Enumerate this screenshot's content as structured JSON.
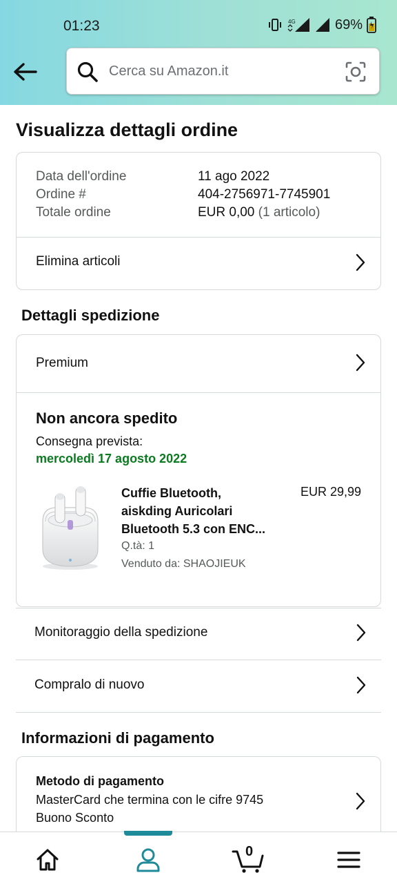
{
  "status_bar": {
    "time": "01:23",
    "battery": "69%",
    "network": "4G"
  },
  "search": {
    "placeholder": "Cerca su Amazon.it"
  },
  "page_title": "Visualizza dettagli ordine",
  "summary": {
    "rows": [
      {
        "label": "Data dell'ordine",
        "value": "11 ago 2022",
        "extra": ""
      },
      {
        "label": "Ordine #",
        "value": "404-2756971-7745901",
        "extra": ""
      },
      {
        "label": "Totale ordine",
        "value": "EUR 0,00",
        "extra": "(1 articolo)"
      }
    ],
    "delete_items": "Elimina articoli"
  },
  "shipping": {
    "section_title": "Dettagli spedizione",
    "method": "Premium",
    "status": "Non ancora spedito",
    "expected_label": "Consegna prevista:",
    "expected_date": "mercoledì 17 agosto 2022",
    "product": {
      "title_line1": "Cuffie Bluetooth,",
      "title_line2": "aiskding Auricolari",
      "title_line3": "Bluetooth 5.3 con ENC...",
      "price": "EUR 29,99",
      "qty": "Q.tà: 1",
      "seller": "Venduto da: SHAOJIEUK"
    }
  },
  "actions": {
    "track": "Monitoraggio della spedizione",
    "buy_again": "Compralo di nuovo"
  },
  "payment": {
    "section_title": "Informazioni di pagamento",
    "method_title": "Metodo di pagamento",
    "line1": "MasterCard che termina con le cifre 9745",
    "line2": "Buono Sconto"
  },
  "bottom_nav": {
    "cart_count": "0",
    "items": [
      "home-icon",
      "account-icon",
      "cart-icon",
      "menu-icon"
    ],
    "active": "account-icon"
  },
  "colors": {
    "accent": "#1f8a9a",
    "delivery_green": "#0c7a21",
    "header_gradient_start": "#85d8e1",
    "header_gradient_end": "#a8e6cf"
  }
}
